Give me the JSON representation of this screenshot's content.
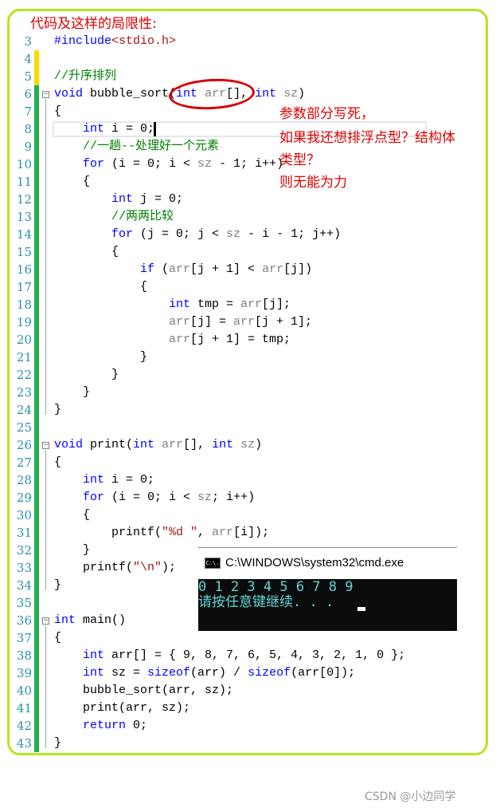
{
  "title": "代码及这样的局限性:",
  "code_lines": [
    {
      "n": "3",
      "mark": "none",
      "tokens": [
        {
          "t": "#include",
          "c": "kw"
        },
        {
          "t": "<stdio.h>",
          "c": "str"
        }
      ],
      "indent": 0
    },
    {
      "n": "4",
      "mark": "yellow",
      "tokens": [],
      "indent": 0
    },
    {
      "n": "5",
      "mark": "yellow",
      "tokens": [
        {
          "t": "//升序排列",
          "c": "cm"
        }
      ],
      "indent": 0
    },
    {
      "n": "6",
      "mark": "green",
      "fold": true,
      "tokens": [
        {
          "t": "void",
          "c": "kw"
        },
        {
          "t": " bubble_sort(",
          "c": ""
        },
        {
          "t": "int",
          "c": "kw"
        },
        {
          "t": " arr",
          "c": "pm"
        },
        {
          "t": "[], ",
          "c": ""
        },
        {
          "t": "int",
          "c": "kw"
        },
        {
          "t": " sz",
          "c": "pm"
        },
        {
          "t": ")",
          "c": ""
        }
      ],
      "indent": 0
    },
    {
      "n": "7",
      "mark": "green",
      "tokens": [
        {
          "t": "{",
          "c": ""
        }
      ],
      "indent": 0
    },
    {
      "n": "8",
      "mark": "green",
      "tokens": [
        {
          "t": "int",
          "c": "kw"
        },
        {
          "t": " i = 0;",
          "c": ""
        }
      ],
      "indent": 1
    },
    {
      "n": "9",
      "mark": "green",
      "tokens": [
        {
          "t": "//一趟--处理好一个元素",
          "c": "cm"
        }
      ],
      "indent": 1
    },
    {
      "n": "10",
      "mark": "green",
      "tokens": [
        {
          "t": "for",
          "c": "kw"
        },
        {
          "t": " (i = 0; i < ",
          "c": ""
        },
        {
          "t": "sz",
          "c": "pm"
        },
        {
          "t": " - 1; i++)",
          "c": ""
        }
      ],
      "indent": 1
    },
    {
      "n": "11",
      "mark": "green",
      "tokens": [
        {
          "t": "{",
          "c": ""
        }
      ],
      "indent": 1
    },
    {
      "n": "12",
      "mark": "green",
      "tokens": [
        {
          "t": "int",
          "c": "kw"
        },
        {
          "t": " j = 0;",
          "c": ""
        }
      ],
      "indent": 2
    },
    {
      "n": "13",
      "mark": "green",
      "tokens": [
        {
          "t": "//两两比较",
          "c": "cm"
        }
      ],
      "indent": 2
    },
    {
      "n": "14",
      "mark": "green",
      "tokens": [
        {
          "t": "for",
          "c": "kw"
        },
        {
          "t": " (j = 0; j < ",
          "c": ""
        },
        {
          "t": "sz",
          "c": "pm"
        },
        {
          "t": " - i - 1; j++)",
          "c": ""
        }
      ],
      "indent": 2
    },
    {
      "n": "15",
      "mark": "green",
      "tokens": [
        {
          "t": "{",
          "c": ""
        }
      ],
      "indent": 2
    },
    {
      "n": "16",
      "mark": "green",
      "tokens": [
        {
          "t": "if",
          "c": "kw"
        },
        {
          "t": " (",
          "c": ""
        },
        {
          "t": "arr",
          "c": "pm"
        },
        {
          "t": "[j + 1] < ",
          "c": ""
        },
        {
          "t": "arr",
          "c": "pm"
        },
        {
          "t": "[j])",
          "c": ""
        }
      ],
      "indent": 3
    },
    {
      "n": "17",
      "mark": "green",
      "tokens": [
        {
          "t": "{",
          "c": ""
        }
      ],
      "indent": 3
    },
    {
      "n": "18",
      "mark": "green",
      "tokens": [
        {
          "t": "int",
          "c": "kw"
        },
        {
          "t": " tmp = ",
          "c": ""
        },
        {
          "t": "arr",
          "c": "pm"
        },
        {
          "t": "[j];",
          "c": ""
        }
      ],
      "indent": 4
    },
    {
      "n": "19",
      "mark": "green",
      "tokens": [
        {
          "t": "arr",
          "c": "pm"
        },
        {
          "t": "[j] = ",
          "c": ""
        },
        {
          "t": "arr",
          "c": "pm"
        },
        {
          "t": "[j + 1];",
          "c": ""
        }
      ],
      "indent": 4
    },
    {
      "n": "20",
      "mark": "green",
      "tokens": [
        {
          "t": "arr",
          "c": "pm"
        },
        {
          "t": "[j + 1] = tmp;",
          "c": ""
        }
      ],
      "indent": 4
    },
    {
      "n": "21",
      "mark": "green",
      "tokens": [
        {
          "t": "}",
          "c": ""
        }
      ],
      "indent": 3
    },
    {
      "n": "22",
      "mark": "green",
      "tokens": [
        {
          "t": "}",
          "c": ""
        }
      ],
      "indent": 2
    },
    {
      "n": "23",
      "mark": "green",
      "tokens": [
        {
          "t": "}",
          "c": ""
        }
      ],
      "indent": 1
    },
    {
      "n": "24",
      "mark": "green",
      "tokens": [
        {
          "t": "}",
          "c": ""
        }
      ],
      "indent": 0
    },
    {
      "n": "25",
      "mark": "green",
      "tokens": [],
      "indent": 0
    },
    {
      "n": "26",
      "mark": "green",
      "fold": true,
      "tokens": [
        {
          "t": "void",
          "c": "kw"
        },
        {
          "t": " print(",
          "c": ""
        },
        {
          "t": "int",
          "c": "kw"
        },
        {
          "t": " arr",
          "c": "pm"
        },
        {
          "t": "[], ",
          "c": ""
        },
        {
          "t": "int",
          "c": "kw"
        },
        {
          "t": " sz",
          "c": "pm"
        },
        {
          "t": ")",
          "c": ""
        }
      ],
      "indent": 0
    },
    {
      "n": "27",
      "mark": "green",
      "tokens": [
        {
          "t": "{",
          "c": ""
        }
      ],
      "indent": 0
    },
    {
      "n": "28",
      "mark": "green",
      "tokens": [
        {
          "t": "int",
          "c": "kw"
        },
        {
          "t": " i = 0;",
          "c": ""
        }
      ],
      "indent": 1
    },
    {
      "n": "29",
      "mark": "green",
      "tokens": [
        {
          "t": "for",
          "c": "kw"
        },
        {
          "t": " (i = 0; i < ",
          "c": ""
        },
        {
          "t": "sz",
          "c": "pm"
        },
        {
          "t": "; i++)",
          "c": ""
        }
      ],
      "indent": 1
    },
    {
      "n": "30",
      "mark": "green",
      "tokens": [
        {
          "t": "{",
          "c": ""
        }
      ],
      "indent": 1
    },
    {
      "n": "31",
      "mark": "green",
      "tokens": [
        {
          "t": "printf(",
          "c": ""
        },
        {
          "t": "\"%d \"",
          "c": "str"
        },
        {
          "t": ", ",
          "c": ""
        },
        {
          "t": "arr",
          "c": "pm"
        },
        {
          "t": "[i]);",
          "c": ""
        }
      ],
      "indent": 2
    },
    {
      "n": "32",
      "mark": "green",
      "tokens": [
        {
          "t": "}",
          "c": ""
        }
      ],
      "indent": 1
    },
    {
      "n": "33",
      "mark": "green",
      "tokens": [
        {
          "t": "printf(",
          "c": ""
        },
        {
          "t": "\"\\n\"",
          "c": "str"
        },
        {
          "t": ");",
          "c": ""
        }
      ],
      "indent": 1
    },
    {
      "n": "34",
      "mark": "green",
      "tokens": [
        {
          "t": "}",
          "c": ""
        }
      ],
      "indent": 0
    },
    {
      "n": "35",
      "mark": "green",
      "tokens": [],
      "indent": 0
    },
    {
      "n": "36",
      "mark": "green",
      "fold": true,
      "tokens": [
        {
          "t": "int",
          "c": "kw"
        },
        {
          "t": " main()",
          "c": ""
        }
      ],
      "indent": 0
    },
    {
      "n": "37",
      "mark": "green",
      "tokens": [
        {
          "t": "{",
          "c": ""
        }
      ],
      "indent": 0
    },
    {
      "n": "38",
      "mark": "green",
      "tokens": [
        {
          "t": "int",
          "c": "kw"
        },
        {
          "t": " arr[] = { 9, 8, 7, 6, 5, 4, 3, 2, 1, 0 };",
          "c": ""
        }
      ],
      "indent": 1
    },
    {
      "n": "39",
      "mark": "green",
      "tokens": [
        {
          "t": "int",
          "c": "kw"
        },
        {
          "t": " sz = ",
          "c": ""
        },
        {
          "t": "sizeof",
          "c": "kw"
        },
        {
          "t": "(arr) / ",
          "c": ""
        },
        {
          "t": "sizeof",
          "c": "kw"
        },
        {
          "t": "(arr[0]);",
          "c": ""
        }
      ],
      "indent": 1
    },
    {
      "n": "40",
      "mark": "green",
      "tokens": [
        {
          "t": "bubble_sort(arr, sz);",
          "c": ""
        }
      ],
      "indent": 1
    },
    {
      "n": "41",
      "mark": "green",
      "tokens": [
        {
          "t": "print(arr, sz);",
          "c": ""
        }
      ],
      "indent": 1
    },
    {
      "n": "42",
      "mark": "green",
      "tokens": [
        {
          "t": "return",
          "c": "kw"
        },
        {
          "t": " 0;",
          "c": ""
        }
      ],
      "indent": 1
    },
    {
      "n": "43",
      "mark": "green",
      "tokens": [
        {
          "t": "}",
          "c": ""
        }
      ],
      "indent": 0
    }
  ],
  "annotation": {
    "lines": [
      "参数部分写死，",
      "如果我还想排浮点型？结构体",
      "类型？",
      "则无能为力"
    ]
  },
  "console": {
    "icon": "C:\\.",
    "title": "C:\\WINDOWS\\system32\\cmd.exe",
    "output": [
      "0 1 2 3 4 5 6 7 8 9",
      "请按任意键继续. . . "
    ]
  },
  "colors": {
    "frame": "#b5e61d",
    "annotation": "#e00000",
    "mark_yellow": "#ffd800",
    "mark_green": "#22b14c"
  },
  "watermark": "CSDN @小边同学"
}
